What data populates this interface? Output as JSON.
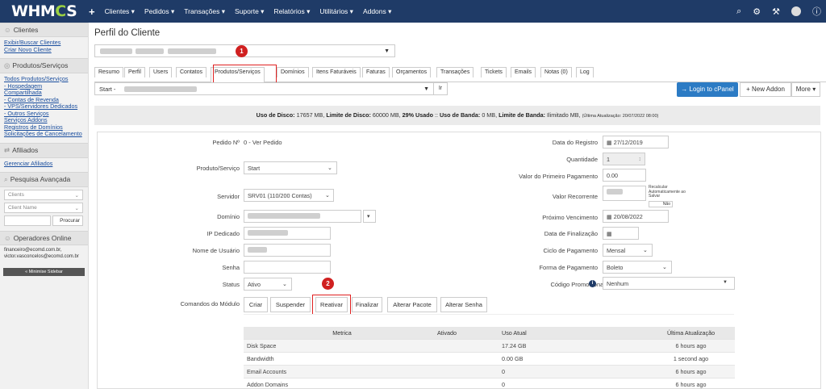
{
  "app": {
    "logo_prefix": "WHM",
    "logo_accent": "C",
    "logo_suffix": "S"
  },
  "nav": [
    "Clientes ▾",
    "Pedidos ▾",
    "Transações ▾",
    "Suporte ▾",
    "Relatórios ▾",
    "Utilitários ▾",
    "Addons ▾"
  ],
  "sidebar": {
    "clients_title": "Clientes",
    "clients_links": [
      "Exibir/Buscar Clientes",
      "Criar Novo Cliente"
    ],
    "products_title": "Produtos/Serviços",
    "products_links": [
      "Todos Produtos/Serviços",
      "- Hospedagem",
      "Compartilhada",
      "- Contas de Revenda",
      "- VPS/Servidores Dedicados",
      "- Outros Serviços",
      "Serviços Addons",
      "Registros de Domínios",
      "Solicitações de Cancelamento"
    ],
    "affiliates_title": "Afiliados",
    "affiliates_links": [
      "Gerenciar Afiliados"
    ],
    "search_title": "Pesquisa Avançada",
    "search_type": "Clients",
    "search_field": "Client Name",
    "search_button": "Procurar",
    "operators_title": "Operadores Online",
    "operators": [
      "financeiro@ecomd.com.br,",
      "victor.vasconcelos@ecomd.com.br"
    ],
    "minimise": "« Minimise Sidebar"
  },
  "page": {
    "title": "Perfil do Cliente",
    "tabs": [
      "Resumo",
      "Perfil",
      "Users",
      "Contatos",
      "Produtos/Serviços",
      "Domínios",
      "Itens Faturáveis",
      "Faturas",
      "Orçamentos",
      "Transações",
      "Tickets",
      "Emails",
      "Notas (0)",
      "Log"
    ],
    "service_select": "Start -",
    "ir_button": "Ir",
    "login_button": "Login to cPanel",
    "new_addon_button": "New Addon",
    "more_button": "More ▾"
  },
  "usage": {
    "disk_label": "Uso de Disco:",
    "disk_value": "17657 MB,",
    "limit_label": "Limite de Disco:",
    "limit_value": "60000 MB,",
    "pct": "29% Usado",
    "sep": "::",
    "bw_label": "Uso de Banda:",
    "bw_value": "0 MB,",
    "bwlimit_label": "Limite de Banda:",
    "bwlimit_value": "Ilimitado MB,",
    "updated": "(Última Atualização: 20/07/2022 08:00)"
  },
  "form": {
    "order_label": "Pedido Nº",
    "order_value": "0 - Ver Pedido",
    "product_label": "Produto/Serviço",
    "product_value": "Start",
    "server_label": "Servidor",
    "server_value": "SRV01 (110/200 Contas)",
    "domain_label": "Domínio",
    "ip_label": "IP Dedicado",
    "user_label": "Nome de Usuário",
    "password_label": "Senha",
    "status_label": "Status",
    "status_value": "Ativo",
    "commands_label": "Comandos do Módulo",
    "reg_date_label": "Data do Registro",
    "reg_date_value": "27/12/2019",
    "qty_label": "Quantidade",
    "qty_value": "1",
    "first_pay_label": "Valor do Primeiro Pagamento",
    "first_pay_value": "0.00",
    "recurring_label": "Valor Recorrente",
    "recalc_text": "Recalcular Automaticamente ao Salvar",
    "recalc_toggle": "Não",
    "next_due_label": "Próximo Vencimento",
    "next_due_value": "20/08/2022",
    "end_date_label": "Data de Finalização",
    "cycle_label": "Ciclo de Pagamento",
    "cycle_value": "Mensal",
    "payment_label": "Forma de Pagamento",
    "payment_value": "Boleto",
    "promo_label": "Código Promocional",
    "promo_value": "Nenhum"
  },
  "commands": [
    "Criar",
    "Suspender",
    "Reativar",
    "Finalizar",
    "Alterar Pacote",
    "Alterar Senha"
  ],
  "annotations": [
    "1",
    "2"
  ],
  "metrics": {
    "headers": [
      "Metrica",
      "Ativado",
      "Uso Atual",
      "Última Atualização"
    ],
    "rows": [
      {
        "name": "Disk Space",
        "enabled": "",
        "usage": "17.24 GB",
        "updated": "6 hours ago"
      },
      {
        "name": "Bandwidth",
        "enabled": "",
        "usage": "0.00 GB",
        "updated": "1 second ago"
      },
      {
        "name": "Email Accounts",
        "enabled": "",
        "usage": "0",
        "updated": "6 hours ago"
      },
      {
        "name": "Addon Domains",
        "enabled": "",
        "usage": "0",
        "updated": "6 hours ago"
      }
    ]
  }
}
